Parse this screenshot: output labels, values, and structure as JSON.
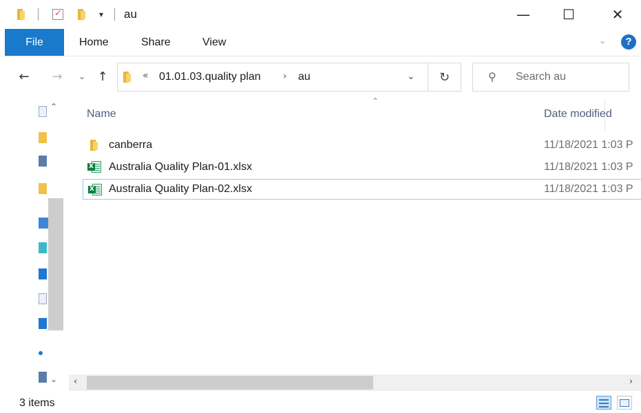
{
  "window": {
    "title": "au",
    "controls": {
      "minimize": "—",
      "maximize": "☐",
      "close": "✕"
    }
  },
  "quick_access": {
    "customize_glyph": "▾"
  },
  "ribbon": {
    "tabs": [
      "File",
      "Home",
      "Share",
      "View"
    ],
    "expand_glyph": "⌄",
    "help_glyph": "?"
  },
  "nav": {
    "back": "←",
    "forward": "→",
    "recent": "⌄",
    "up": "↑"
  },
  "address": {
    "overflow": "«",
    "crumbs": [
      "01.01.03.quality plan",
      "au"
    ],
    "separator": "›",
    "dropdown": "⌄",
    "refresh": "↻"
  },
  "search": {
    "placeholder": "Search au",
    "icon": "search-icon"
  },
  "columns": {
    "name": "Name",
    "date_modified": "Date modified",
    "sort_glyph": "⌃"
  },
  "files": [
    {
      "name": "canberra",
      "date": "11/18/2021 1:03 P",
      "type": "folder",
      "selected": false
    },
    {
      "name": "Australia Quality Plan-01.xlsx",
      "date": "11/18/2021 1:03 P",
      "type": "excel",
      "selected": false
    },
    {
      "name": "Australia Quality Plan-02.xlsx",
      "date": "11/18/2021 1:03 P",
      "type": "excel",
      "selected": true
    }
  ],
  "status": {
    "item_count": "3 items"
  },
  "scroll": {
    "left": "‹",
    "right": "›",
    "up": "⌃",
    "down": "⌄"
  },
  "colors": {
    "accent": "#1979ca",
    "selection_border": "#99c9ef",
    "folder": "#e8b53d",
    "excel": "#107c41"
  }
}
